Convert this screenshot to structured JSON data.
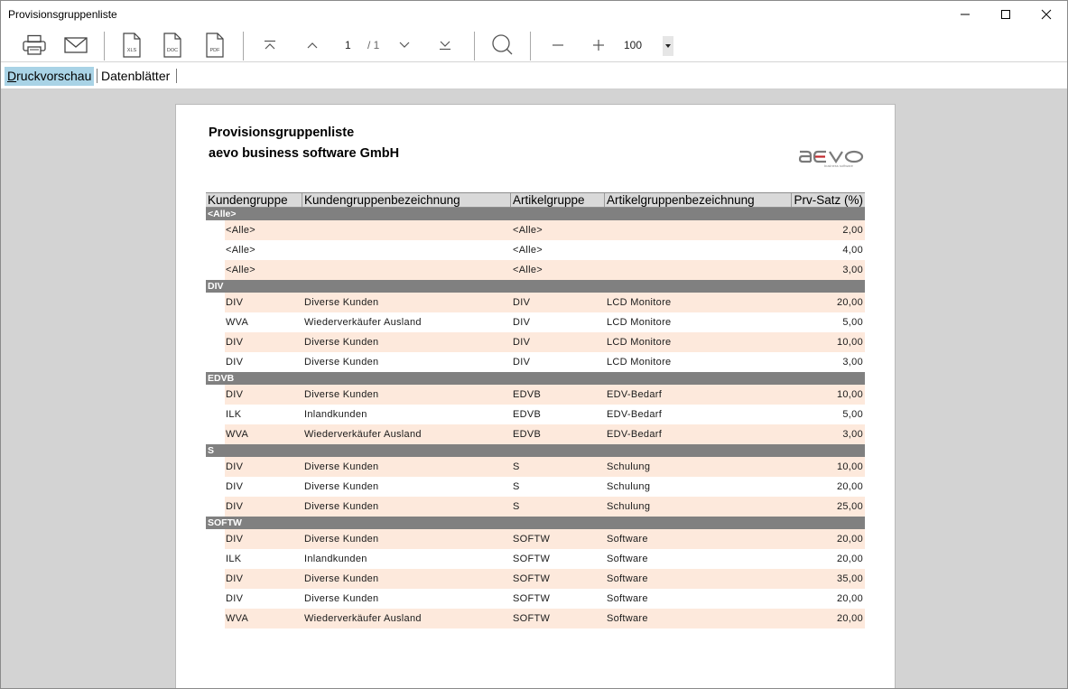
{
  "window": {
    "title": "Provisionsgruppenliste"
  },
  "toolbar": {
    "current_page": "1",
    "total_pages": "/ 1",
    "zoom": "100",
    "xls_label": "XLS",
    "doc_label": "DOC",
    "pdf_label": "PDF"
  },
  "tabs": [
    {
      "label_first": "D",
      "label_rest": "ruckvorschau",
      "active": true
    },
    {
      "label": "Datenblätter",
      "active": false
    }
  ],
  "report": {
    "title": "Provisionsgruppenliste",
    "company": "aevo business software GmbH",
    "logo_text": "aevo",
    "logo_subtext": "business software",
    "columns": [
      "Kundengruppe",
      "Kundengruppenbezeichnung",
      "Artikelgruppe",
      "Artikelgruppenbezeichnung",
      "Prv-Satz (%)"
    ],
    "groups": [
      {
        "name": "<Alle>",
        "rows": [
          [
            "<Alle>",
            "",
            "<Alle>",
            "",
            "2,00"
          ],
          [
            "<Alle>",
            "",
            "<Alle>",
            "",
            "4,00"
          ],
          [
            "<Alle>",
            "",
            "<Alle>",
            "",
            "3,00"
          ]
        ]
      },
      {
        "name": "DIV",
        "rows": [
          [
            "DIV",
            "Diverse Kunden",
            "DIV",
            "LCD Monitore",
            "20,00"
          ],
          [
            "WVA",
            "Wiederverkäufer Ausland",
            "DIV",
            "LCD Monitore",
            "5,00"
          ],
          [
            "DIV",
            "Diverse Kunden",
            "DIV",
            "LCD Monitore",
            "10,00"
          ],
          [
            "DIV",
            "Diverse Kunden",
            "DIV",
            "LCD Monitore",
            "3,00"
          ]
        ]
      },
      {
        "name": "EDVB",
        "rows": [
          [
            "DIV",
            "Diverse Kunden",
            "EDVB",
            "EDV-Bedarf",
            "10,00"
          ],
          [
            "ILK",
            "Inlandkunden",
            "EDVB",
            "EDV-Bedarf",
            "5,00"
          ],
          [
            "WVA",
            "Wiederverkäufer Ausland",
            "EDVB",
            "EDV-Bedarf",
            "3,00"
          ]
        ]
      },
      {
        "name": "S",
        "rows": [
          [
            "DIV",
            "Diverse Kunden",
            "S",
            "Schulung",
            "10,00"
          ],
          [
            "DIV",
            "Diverse Kunden",
            "S",
            "Schulung",
            "20,00"
          ],
          [
            "DIV",
            "Diverse Kunden",
            "S",
            "Schulung",
            "25,00"
          ]
        ]
      },
      {
        "name": "SOFTW",
        "rows": [
          [
            "DIV",
            "Diverse Kunden",
            "SOFTW",
            "Software",
            "20,00"
          ],
          [
            "ILK",
            "Inlandkunden",
            "SOFTW",
            "Software",
            "20,00"
          ],
          [
            "DIV",
            "Diverse Kunden",
            "SOFTW",
            "Software",
            "35,00"
          ],
          [
            "DIV",
            "Diverse Kunden",
            "SOFTW",
            "Software",
            "20,00"
          ],
          [
            "WVA",
            "Wiederverkäufer Ausland",
            "SOFTW",
            "Software",
            "20,00"
          ]
        ]
      }
    ]
  },
  "colors": {
    "active_tab": "#a9d3e6",
    "group_bar": "#808080",
    "row_stripe": "#fde9dc",
    "logo_red": "#c0282d"
  }
}
